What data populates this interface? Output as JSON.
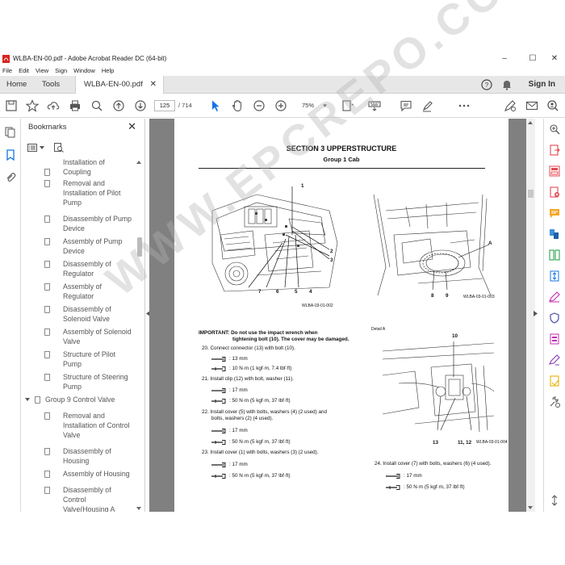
{
  "window": {
    "title": "WLBA-EN-00.pdf - Adobe Acrobat Reader DC (64-bit)",
    "minimize": "–",
    "maximize": "☐",
    "close": "✕"
  },
  "menu": [
    "File",
    "Edit",
    "View",
    "Sign",
    "Window",
    "Help"
  ],
  "tabs": {
    "home": "Home",
    "tools": "Tools",
    "document": "WLBA-EN-00.pdf",
    "close": "✕",
    "sign_in": "Sign In"
  },
  "toolbar": {
    "page_current": "125",
    "page_total": "/ 714",
    "zoom": "75%"
  },
  "bookmarks": {
    "header": "Bookmarks",
    "close": "✕",
    "items": [
      {
        "lines": [
          "Installation of",
          "Coupling"
        ],
        "indent": 2,
        "partial": true
      },
      {
        "lines": [
          "Removal and",
          "Installation of Pilot",
          "Pump"
        ],
        "indent": 2
      },
      {
        "lines": [
          "Disassembly of Pump",
          "Device"
        ],
        "indent": 2
      },
      {
        "lines": [
          "Assembly of Pump",
          "Device"
        ],
        "indent": 2
      },
      {
        "lines": [
          "Disassembly of",
          "Regulator"
        ],
        "indent": 2
      },
      {
        "lines": [
          "Assembly of",
          "Regulator"
        ],
        "indent": 2
      },
      {
        "lines": [
          "Disassembly of",
          "Solenoid Valve"
        ],
        "indent": 2
      },
      {
        "lines": [
          "Assembly of Solenoid",
          "Valve"
        ],
        "indent": 2
      },
      {
        "lines": [
          "Structure of Pilot",
          "Pump"
        ],
        "indent": 2
      },
      {
        "lines": [
          "Structure of Steering",
          "Pump"
        ],
        "indent": 2
      },
      {
        "lines": [
          "Group 9 Control Valve"
        ],
        "indent": 1,
        "expanded": true
      },
      {
        "lines": [
          "Removal and",
          "Installation of Control",
          "Valve"
        ],
        "indent": 2
      },
      {
        "lines": [
          "Disassembly of",
          "Housing"
        ],
        "indent": 2
      },
      {
        "lines": [
          "Assembly of Housing"
        ],
        "indent": 2
      },
      {
        "lines": [
          "Disassembly of",
          "Control",
          "Valve(Housing A"
        ],
        "indent": 2
      }
    ]
  },
  "document": {
    "section_title": "SECTION 3 UPPERSTRUCTURE",
    "group_title": "Group 1 Cab",
    "fig1_caption": "WLBA-03-01-002",
    "fig1_labels": [
      "1",
      "2",
      "3",
      "7",
      "6",
      "5",
      "4"
    ],
    "fig2_caption": "WLBA-03-01-003",
    "fig2_labels": [
      "A",
      "8",
      "9"
    ],
    "fig3_detail": "Detail A",
    "fig3_caption": "WLBA-03-01-004",
    "fig3_labels": [
      "10",
      "13",
      "11, 12"
    ],
    "important_1": "IMPORTANT:   Do not use the impact wrench when",
    "important_2": "tightening bolt (10). The cover may be damaged.",
    "steps": [
      {
        "text": "20.  Connect connector (13) with bolt (10).",
        "wrench": ": 13 mm",
        "torque": ": 10 N·m (1 kgf·m, 7.4 lbf·ft)"
      },
      {
        "text": "21.  Install clip (12) with bolt, washer (11).",
        "wrench": ": 17 mm",
        "torque": ": 50 N·m (5 kgf·m, 37 lbf·ft)"
      },
      {
        "text": "22.  Install cover (5) with bolts, washers (4) (2 used) and",
        "text2": "bolts, washers (2) (4 used).",
        "wrench": ": 17 mm",
        "torque": ": 50 N·m (5 kgf·m, 37 lbf·ft)"
      },
      {
        "text": "23.  Install cover (1) with bolts, washers (3) (2 used).",
        "wrench": ": 17 mm",
        "torque": ": 50 N·m (5 kgf·m, 37 lbf·ft)"
      }
    ],
    "step24": {
      "text": "24.  Install cover (7) with bolts, washers (6) (4 used).",
      "wrench": ": 17 mm",
      "torque": ": 50 N·m (5 kgf·m, 37 lbf·ft)"
    },
    "watermark": "WWW.EPCREPO.COM"
  }
}
